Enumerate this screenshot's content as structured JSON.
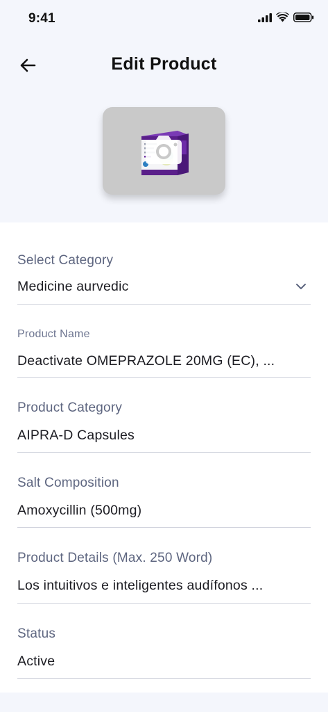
{
  "status_bar": {
    "time": "9:41"
  },
  "header": {
    "title": "Edit Product"
  },
  "fields": {
    "select_category": {
      "label": "Select Category",
      "value": "Medicine aurvedic"
    },
    "product_name": {
      "label": "Product Name",
      "value": "Deactivate OMEPRAZOLE 20MG (EC), ..."
    },
    "product_category": {
      "label": "Product Category",
      "value": "AIPRA-D Capsules"
    },
    "salt_composition": {
      "label": "Salt Composition",
      "value": "Amoxycillin (500mg)"
    },
    "product_details": {
      "label": "Product Details (Max. 250 Word)",
      "value": "Los intuitivos e inteligentes audífonos ..."
    },
    "status": {
      "label": "Status",
      "value": "Active"
    }
  },
  "icons": {
    "back": "arrow-left-icon",
    "camera": "camera-icon",
    "dropdown": "chevron-down-icon",
    "signal": "cellular-signal-icon",
    "wifi": "wifi-icon",
    "battery": "battery-icon"
  },
  "colors": {
    "background": "#f4f6fc",
    "form_background": "#ffffff",
    "label": "#5e6680",
    "divider": "#cfd2dc",
    "photo_placeholder": "#c9c9c9",
    "product_box_purple": "#5a1f8a"
  }
}
